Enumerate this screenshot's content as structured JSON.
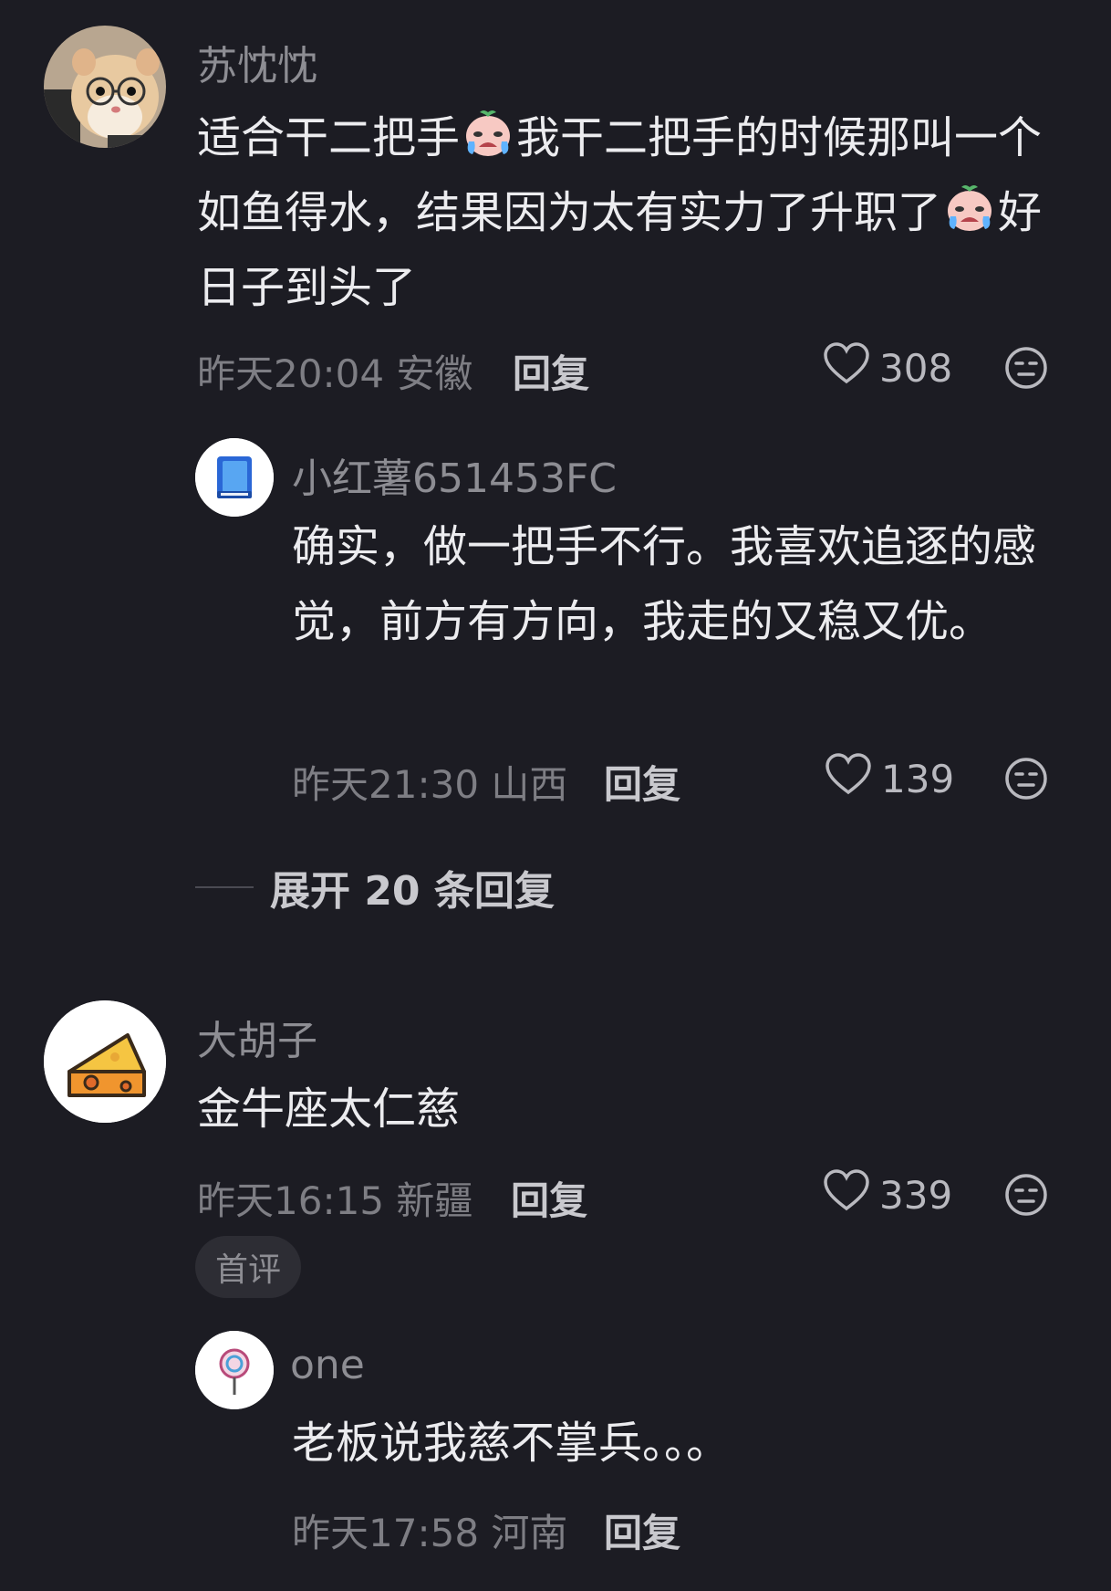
{
  "comments": [
    {
      "username": "苏忱忱",
      "avatar_icon": "hamster-with-glasses-avatar",
      "text_parts": [
        "适合干二把手",
        "我干二把手的时候那叫一个如鱼得水，结果因为太有实力了升职了",
        "好日子到头了"
      ],
      "emoji_icon": "crying-face-emoji",
      "time": "昨天20:04",
      "location": "安徽",
      "reply_label": "回复",
      "likes": "308",
      "replies": [
        {
          "username": "小红薯651453FC",
          "avatar_icon": "blue-book-avatar",
          "text": "确实，做一把手不行。我喜欢追逐的感觉，前方有方向，我走的又稳又优。",
          "time": "昨天21:30",
          "location": "山西",
          "reply_label": "回复",
          "likes": "139"
        }
      ],
      "expand_label": "展开 20 条回复"
    },
    {
      "username": "大胡子",
      "avatar_icon": "cheese-avatar",
      "text": "金牛座太仁慈",
      "time": "昨天16:15",
      "location": "新疆",
      "reply_label": "回复",
      "likes": "339",
      "badge": "首评",
      "replies": [
        {
          "username": "one",
          "avatar_icon": "lollipop-avatar",
          "text": "老板说我慈不掌兵。。。",
          "time": "昨天17:58",
          "location": "河南",
          "reply_label": "回复"
        }
      ]
    }
  ]
}
